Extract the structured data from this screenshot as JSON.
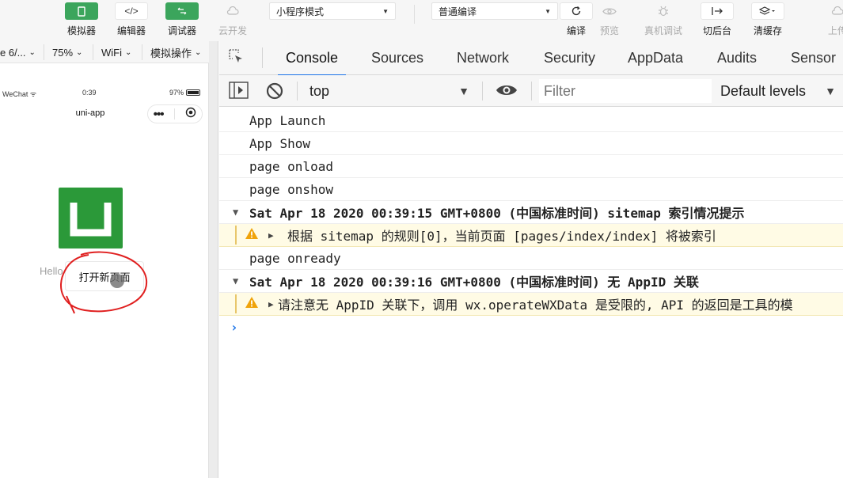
{
  "toolbar": {
    "simulator": "模拟器",
    "editor": "编辑器",
    "debugger": "调试器",
    "cloud_dev": "云开发",
    "mode_select": "小程序模式",
    "compile_select": "普通编译",
    "compile": "编译",
    "preview": "预览",
    "remote_debug": "真机调试",
    "background": "切后台",
    "clear_cache": "清缓存",
    "upload": "上传"
  },
  "sim_bar": {
    "device": "e 6/...",
    "zoom": "75%",
    "network": "WiFi",
    "ops": "模拟操作"
  },
  "phone": {
    "carrier": "WeChat",
    "time": "0:39",
    "battery": "97%",
    "title": "uni-app",
    "logo_letter": "U",
    "hello": "Hello",
    "button": "打开新页面"
  },
  "devtools": {
    "tabs": [
      "Console",
      "Sources",
      "Network",
      "Security",
      "AppData",
      "Audits",
      "Sensor"
    ],
    "context": "top",
    "filter_placeholder": "Filter",
    "levels": "Default levels"
  },
  "console": {
    "lines": [
      "App Launch",
      "App Show",
      "page onload",
      "page onshow",
      "Sat Apr 18 2020 00:39:15 GMT+0800 (中国标准时间) sitemap 索引情况提示",
      "根据 sitemap 的规则[0]，当前页面 [pages/index/index] 将被索引",
      "page onready",
      "Sat Apr 18 2020 00:39:16 GMT+0800 (中国标准时间) 无 AppID 关联",
      "请注意无 AppID 关联下，调用 wx.operateWXData 是受限的, API 的返回是工具的模"
    ]
  },
  "colors": {
    "green": "#3ba55c",
    "logo_green": "#2b9939",
    "accent_blue": "#1a73e8",
    "warning_bg": "#fffbe5",
    "warning_icon": "#f0a30a",
    "annotation_red": "#e02020"
  }
}
